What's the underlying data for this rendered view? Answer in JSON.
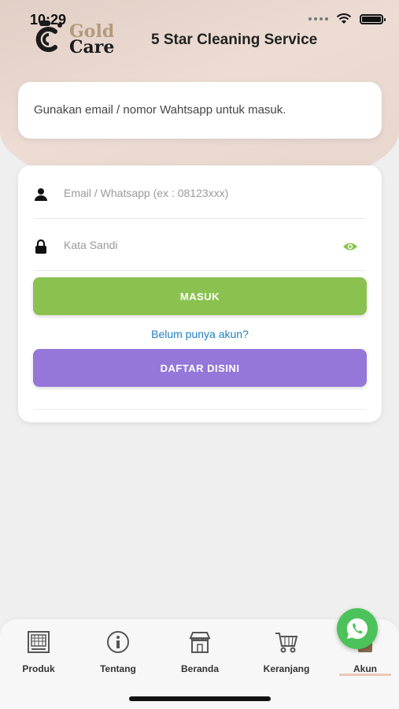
{
  "status_bar": {
    "time": "10:29"
  },
  "header": {
    "logo_line1": "Gold",
    "logo_line2": "Care",
    "title": "5 Star Cleaning Service"
  },
  "info": {
    "text": "Gunakan email / nomor Wahtsapp untuk masuk."
  },
  "login": {
    "email_placeholder": "Email / Whatsapp (ex : 08123xxx)",
    "password_placeholder": "Kata Sandi",
    "login_button": "MASUK",
    "register_prompt": "Belum punya akun?",
    "register_button": "DAFTAR DISINI"
  },
  "nav": {
    "items": [
      {
        "label": "Produk",
        "icon": "product-icon"
      },
      {
        "label": "Tentang",
        "icon": "info-icon"
      },
      {
        "label": "Beranda",
        "icon": "store-icon"
      },
      {
        "label": "Keranjang",
        "icon": "cart-icon"
      },
      {
        "label": "Akun",
        "icon": "account-icon",
        "active": true
      }
    ]
  },
  "colors": {
    "login_button": "#8bc24f",
    "register_button": "#9477d8",
    "link": "#1f7fc4",
    "whatsapp": "#4cc25b",
    "logo_gold": "#b39a7a"
  }
}
